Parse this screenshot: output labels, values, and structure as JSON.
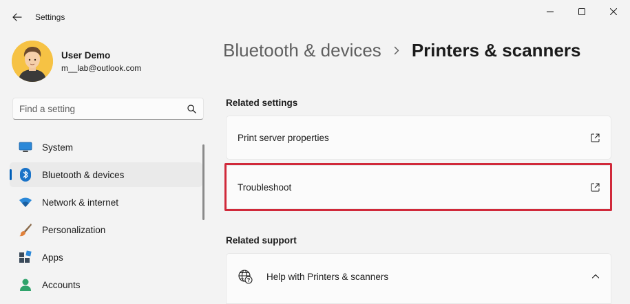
{
  "window": {
    "app_title": "Settings",
    "controls": [
      "minimize",
      "maximize",
      "close"
    ]
  },
  "user": {
    "name": "User Demo",
    "email": "m__lab@outlook.com"
  },
  "search": {
    "placeholder": "Find a setting",
    "value": ""
  },
  "sidebar": {
    "items": [
      {
        "label": "System",
        "icon": "monitor-icon",
        "active": false
      },
      {
        "label": "Bluetooth & devices",
        "icon": "bluetooth-icon",
        "active": true
      },
      {
        "label": "Network & internet",
        "icon": "wifi-icon",
        "active": false
      },
      {
        "label": "Personalization",
        "icon": "brush-icon",
        "active": false
      },
      {
        "label": "Apps",
        "icon": "apps-icon",
        "active": false
      },
      {
        "label": "Accounts",
        "icon": "person-icon",
        "active": false
      }
    ]
  },
  "breadcrumb": {
    "parent": "Bluetooth & devices",
    "current": "Printers & scanners"
  },
  "related_settings": {
    "title": "Related settings",
    "items": [
      {
        "label": "Print server properties",
        "icon": "external-link-icon"
      },
      {
        "label": "Troubleshoot",
        "icon": "external-link-icon",
        "highlighted": true
      }
    ]
  },
  "related_support": {
    "title": "Related support",
    "help_label": "Help with Printers & scanners",
    "expanded": true
  },
  "colors": {
    "accent": "#005fb8",
    "highlight": "#d0293a",
    "background": "#f3f3f3"
  }
}
